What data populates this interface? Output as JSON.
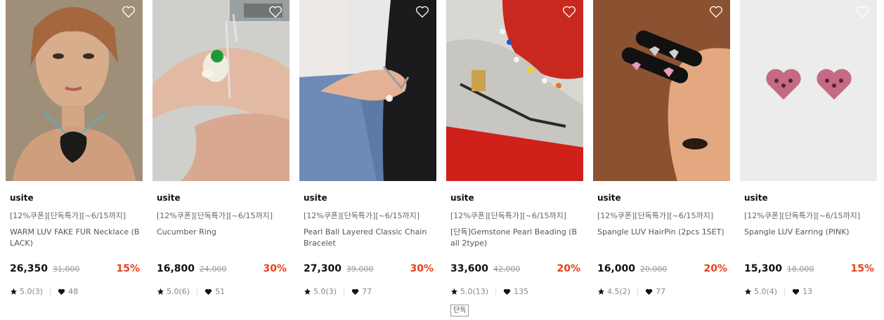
{
  "products": [
    {
      "brand": "usite",
      "promo": "[12%쿠폰][단독특가][~6/15까지]",
      "name": "WARM LUV FAKE FUR Necklace (BLACK)",
      "price": "26,350",
      "original_price": "31,000",
      "discount": "15%",
      "rating": "5.0(3)",
      "likes": "48"
    },
    {
      "brand": "usite",
      "promo": "[12%쿠폰][단독특가][~6/15까지]",
      "name": "Cucumber Ring",
      "price": "16,800",
      "original_price": "24,000",
      "discount": "30%",
      "rating": "5.0(6)",
      "likes": "51"
    },
    {
      "brand": "usite",
      "promo": "[12%쿠폰][단독특가][~6/15까지]",
      "name": "Pearl Ball Layered Classic Chain Bracelet",
      "price": "27,300",
      "original_price": "39,000",
      "discount": "30%",
      "rating": "5.0(3)",
      "likes": "77"
    },
    {
      "brand": "usite",
      "promo": "[12%쿠폰][단독특가][~6/15까지]",
      "name": "[단독]Gemstone Pearl Beading (Ball 2type)",
      "price": "33,600",
      "original_price": "42,000",
      "discount": "20%",
      "rating": "5.0(13)",
      "likes": "135",
      "tag": "단독"
    },
    {
      "brand": "usite",
      "promo": "[12%쿠폰][단독특가][~6/15까지]",
      "name": "Spangle LUV HairPin (2pcs 1SET)",
      "price": "16,000",
      "original_price": "20,000",
      "discount": "20%",
      "rating": "4.5(2)",
      "likes": "77"
    },
    {
      "brand": "usite",
      "promo": "[12%쿠폰][단독특가][~6/15까지]",
      "name": "Spangle LUV Earring (PINK)",
      "price": "15,300",
      "original_price": "18,000",
      "discount": "15%",
      "rating": "5.0(4)",
      "likes": "13"
    }
  ],
  "colors": {
    "discount": "#e8401c",
    "heart_outline": "#ffffff"
  },
  "icons": {
    "wishlist": "heart-outline-icon",
    "rating": "star-icon",
    "likes": "heart-filled-icon"
  }
}
